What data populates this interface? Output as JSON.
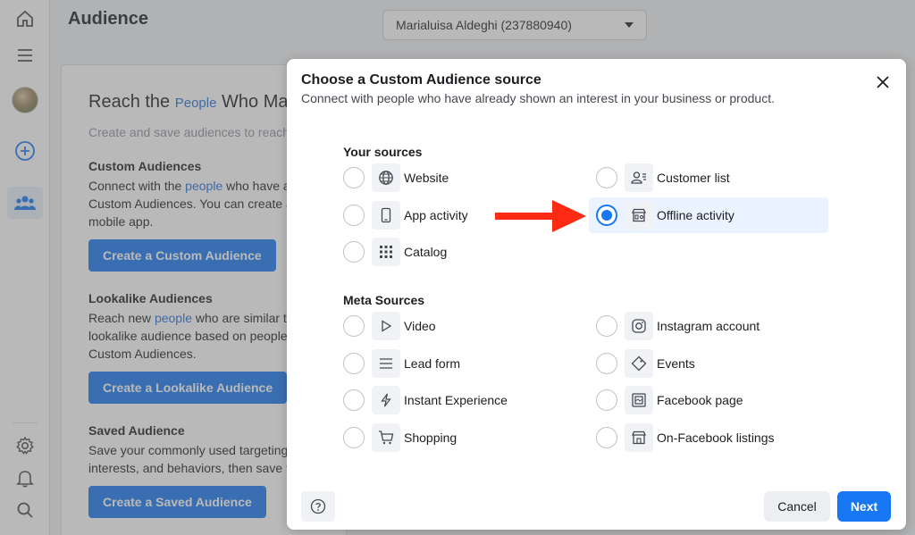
{
  "header": {
    "title": "Audience",
    "account_selector": "Marialuisa Aldeghi (237880940)"
  },
  "background": {
    "headline_pre": "Reach the ",
    "headline_link": "People",
    "headline_post": " Who Matter",
    "intro": "Create and save audiences to reach",
    "sections": [
      {
        "title": "Custom Audiences",
        "text_pre": "Connect with the ",
        "text_link": "people",
        "text_post": " who have a",
        "text_line2": "Custom Audiences. You can create a",
        "text_line3": "mobile app.",
        "button": "Create a Custom Audience"
      },
      {
        "title": "Lookalike Audiences",
        "text_pre": "Reach new ",
        "text_link": "people",
        "text_post": " who are similar to",
        "text_line2": "lookalike audience based on people",
        "text_line3": "Custom Audiences.",
        "button": "Create a Lookalike Audience"
      },
      {
        "title": "Saved Audience",
        "text_line1": "Save your commonly used targeting",
        "text_line2": "interests, and behaviors, then save th",
        "button": "Create a Saved Audience"
      }
    ]
  },
  "modal": {
    "title": "Choose a Custom Audience source",
    "subtitle": "Connect with people who have already shown an interest in your business or product.",
    "your_sources_label": "Your sources",
    "meta_sources_label": "Meta Sources",
    "your_sources": [
      {
        "label": "Website",
        "icon": "globe-icon",
        "checked": false
      },
      {
        "label": "Customer list",
        "icon": "customer-list-icon",
        "checked": false
      },
      {
        "label": "App activity",
        "icon": "mobile-app-icon",
        "checked": false
      },
      {
        "label": "Offline activity",
        "icon": "store-icon",
        "checked": true
      },
      {
        "label": "Catalog",
        "icon": "grid-icon",
        "checked": false
      }
    ],
    "meta_sources": [
      {
        "label": "Video",
        "icon": "play-icon"
      },
      {
        "label": "Instagram account",
        "icon": "instagram-icon"
      },
      {
        "label": "Lead form",
        "icon": "list-icon"
      },
      {
        "label": "Events",
        "icon": "ticket-icon"
      },
      {
        "label": "Instant Experience",
        "icon": "lightning-icon"
      },
      {
        "label": "Facebook page",
        "icon": "page-icon"
      },
      {
        "label": "Shopping",
        "icon": "cart-icon"
      },
      {
        "label": "On-Facebook listings",
        "icon": "listing-store-icon"
      }
    ],
    "cancel": "Cancel",
    "next": "Next"
  },
  "colors": {
    "accent": "#1877f2",
    "arrow": "#ff2a14",
    "selected_row": "#eaf3ff"
  }
}
